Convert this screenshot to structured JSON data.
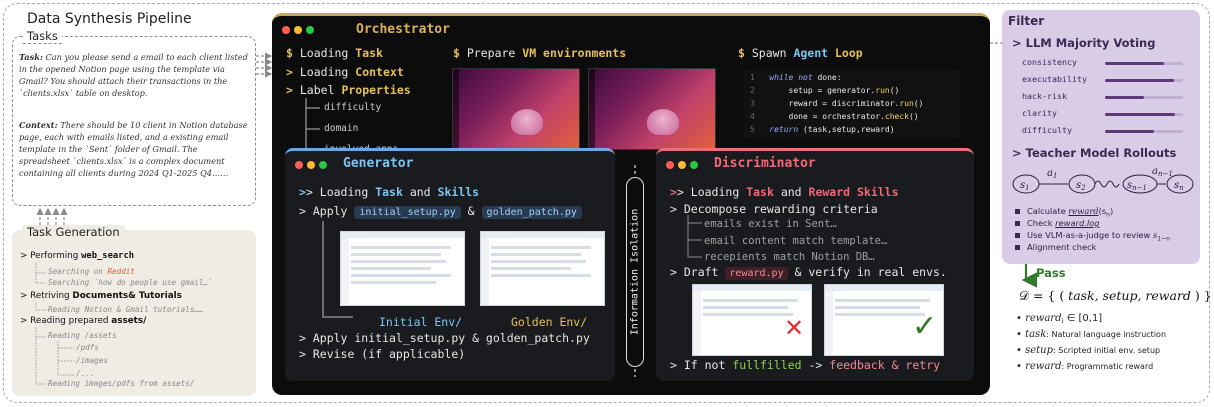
{
  "page": {
    "title": "Data Synthesis Pipeline"
  },
  "tasks": {
    "label": "Tasks",
    "task_label": "Task:",
    "task_text": "Can you please send a email to each client listed in the opened Notion page using the template via Gmail? You should attach their transactions in the `clients.xlsx` table on desktop.",
    "context_label": "Context:",
    "context_text": "There should be 10 client in Notion database page, each with emails listed, and a existing email template in the `Sent` folder of Gmail. The spreadsheet `clients.xlsx` is a complex document containing all clients during 2024 Q1-2025 Q4……"
  },
  "task_generation": {
    "label": "Task Generation",
    "performing": "> Performing ",
    "web_search": "web_search",
    "searching_on": "Searching on ",
    "reddit": "Reddit",
    "searching_how": "Searching `how do people use gmail…`",
    "retrieving": "> Retriving ",
    "documents": "Documents& Tutorials",
    "reading_notion": "Reading Notion & Gmail tutorials……",
    "reading_prepared": "> Reading prepared ",
    "assets": "assets/",
    "reading_assets": "Reading /assets",
    "pdfs": "/pdfs",
    "images": "/images",
    "dots": "/...",
    "reading_images": "Reading images/pdfs from assets/"
  },
  "orchestrator": {
    "title": "Orchestrator",
    "prompt": "$",
    "loading": "Loading",
    "task": "Task",
    "context": "Context",
    "label": "Label",
    "properties": "Properties",
    "props": [
      "difficulty",
      "domain",
      "involved apps"
    ],
    "prepare": "Prepare",
    "vm_env": "VM environments",
    "spawn": "Spawn",
    "agent": "Agent",
    "loop": "Loop",
    "code": {
      "line_numbers": [
        "1",
        "2",
        "3",
        "4",
        "5"
      ],
      "while": "while",
      "not": "not",
      "done": "done:",
      "setup_assign": "setup = generator.",
      "run1": "run",
      "reward_assign": "reward = discriminator.",
      "run2": "run",
      "done_assign": "done = orchestrator.",
      "check": "check",
      "parens": "()",
      "return": "return",
      "return_tuple": "(task,setup,reward)"
    }
  },
  "generator": {
    "title": "Generator",
    "loading": "> Loading ",
    "task": "Task",
    "and": " and ",
    "skills": "Skills",
    "apply": "> Apply",
    "initial_setup": "initial_setup.py",
    "amp": "&",
    "golden_patch": "golden_patch.py",
    "initial_env": "Initial Env/",
    "golden_env": "Golden Env/",
    "apply_both": "> Apply initial_setup.py & golden_patch.py",
    "revise": "> Revise (if applicable)"
  },
  "isolation": {
    "label": "Information Isolation"
  },
  "discriminator": {
    "title": "Discriminator",
    "loading": "> Loading ",
    "task": "Task",
    "and": " and ",
    "reward_skills": "Reward Skills",
    "decompose": "> Decompose rewarding criteria",
    "criteria": [
      "emails exist in Sent…",
      "email content match template…",
      "recepients match Notion DB…"
    ],
    "draft": "> Draft",
    "reward_py": "reward.py",
    "verify": "& verify in real envs.",
    "if_not": "> If not ",
    "fulfilled": "fullfilled",
    "arrow": " -> ",
    "feedback": "feedback & retry",
    "cross": "✕",
    "check": "✓"
  },
  "filter": {
    "title": "Filter",
    "llm_voting": "> LLM Majority Voting",
    "metrics": [
      {
        "label": "consistency",
        "value": 0.75
      },
      {
        "label": "executability",
        "value": 0.88
      },
      {
        "label": "hack-risk",
        "value": 0.5
      },
      {
        "label": "clarity",
        "value": 0.9
      },
      {
        "label": "difficulty",
        "value": 0.63
      }
    ],
    "teacher": "> Teacher Model Rollouts",
    "chain": {
      "s1": "s",
      "s1_sub": "1",
      "a1": "a",
      "a1_sub": "1",
      "s2": "s",
      "s2_sub": "2",
      "sn1": "s",
      "sn1_sub": "n−1",
      "an1": "a",
      "an1_sub": "n−1",
      "sn": "s",
      "sn_sub": "n"
    },
    "bullets": {
      "calc": "Calculate ",
      "calc_reward": "reward",
      "calc_arg": "(s",
      "calc_arg_sub": "n",
      "calc_close": ")",
      "check": "Check ",
      "check_log": "reward.log",
      "vlm": "Use VLM-as-a-judge to review ",
      "vlm_s": "s",
      "vlm_sub": "1−n",
      "alignment": "Alignment check"
    },
    "pass": "Pass"
  },
  "dataset": {
    "formula_prefix": "𝒟 = { ( ",
    "formula_body": "task, setup, reward",
    "formula_suffix": " ) }",
    "defs": [
      {
        "term": "reward",
        "sub": "i",
        "desc": " ∈ [0,1]"
      },
      {
        "term": "task",
        "sub": "",
        "desc": ":  Natural language instruction"
      },
      {
        "term": "setup",
        "sub": "",
        "desc": ":  Scripted initial env. setup"
      },
      {
        "term": "reward",
        "sub": "",
        "desc": ":        Programmatic reward"
      }
    ]
  },
  "colors": {
    "orchestrator_accent": "#d8b25a",
    "generator_accent": "#7cc6f2",
    "discriminator_accent": "#f0687a",
    "filter_bg": "#d9cce6",
    "pass_green": "#2f7a2a"
  }
}
